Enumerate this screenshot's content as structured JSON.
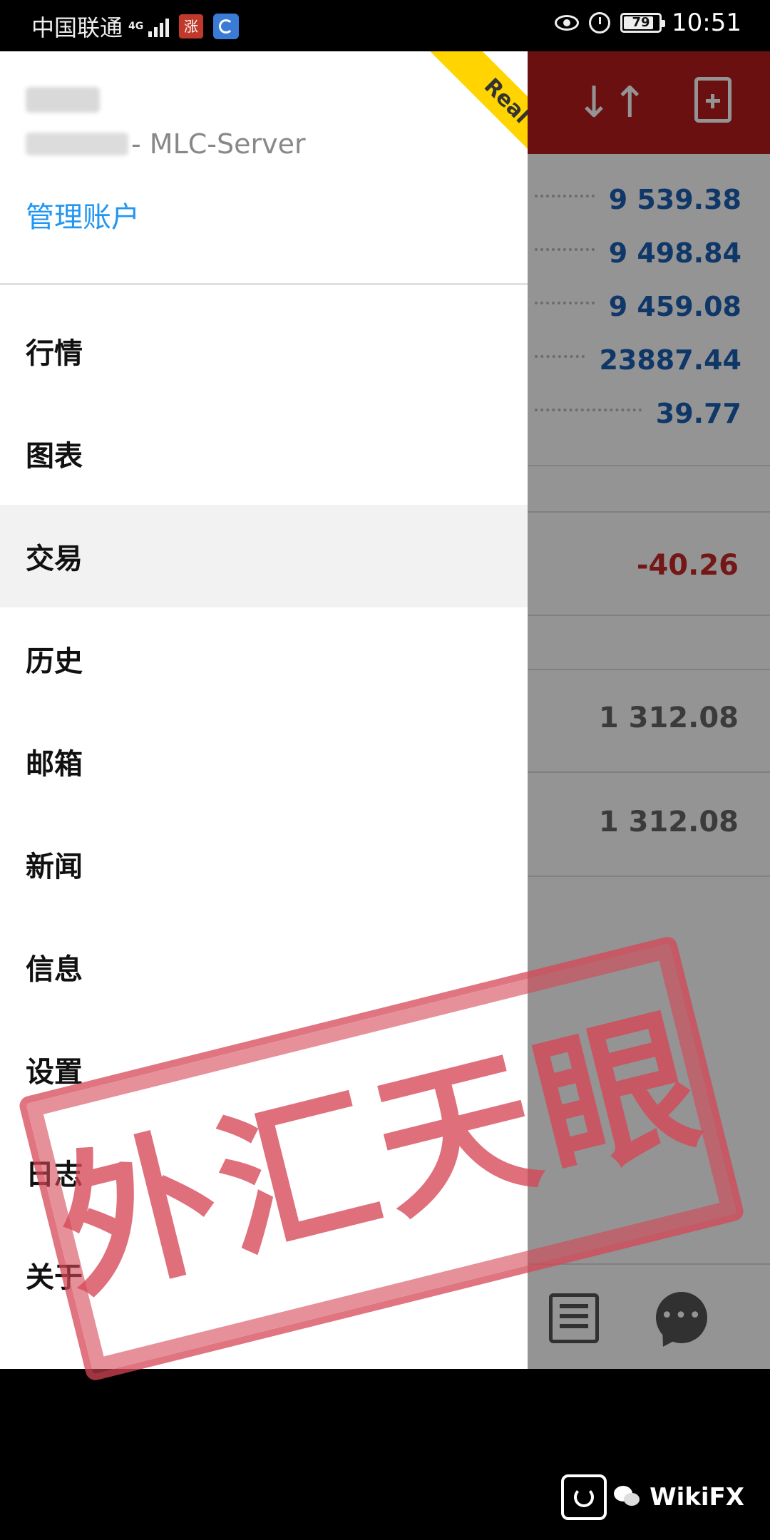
{
  "status_bar": {
    "carrier": "中国联通",
    "network": "4G",
    "app_badge": "涨",
    "battery": "79",
    "time": "10:51"
  },
  "drawer": {
    "server": "- MLC-Server",
    "manage_accounts": "管理账户",
    "badge": "Real",
    "menu": [
      {
        "label": "行情"
      },
      {
        "label": "图表"
      },
      {
        "label": "交易"
      },
      {
        "label": "历史"
      },
      {
        "label": "邮箱"
      },
      {
        "label": "新闻"
      },
      {
        "label": "信息"
      },
      {
        "label": "设置"
      },
      {
        "label": "日志"
      },
      {
        "label": "关于"
      }
    ],
    "active_index": 2
  },
  "background_app": {
    "account_values": [
      "9 539.38",
      "9 498.84",
      "9 459.08",
      "23887.44",
      "39.77"
    ],
    "profit": "-40.26",
    "prices": [
      "1 312.08",
      "1 312.08"
    ],
    "colors": {
      "toolbar": "#b71c1c",
      "value_blue": "#1a5fb4",
      "profit_red": "#c62828",
      "badge_yellow": "#ffd400"
    }
  },
  "watermark": {
    "stamp": "外汇天眼",
    "logo": "WikiFX"
  }
}
